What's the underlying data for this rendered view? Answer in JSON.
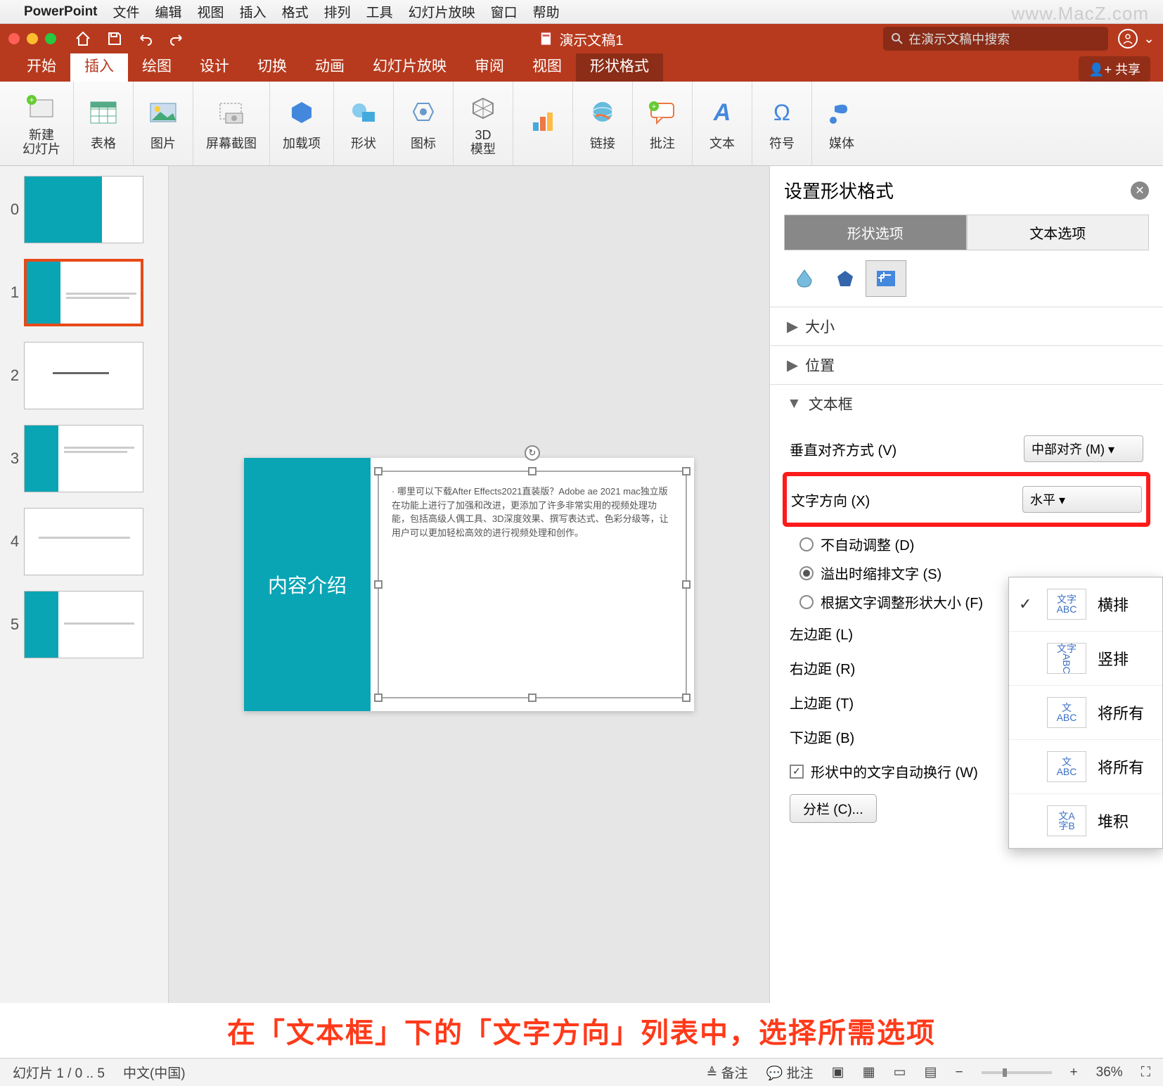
{
  "mac_menu": {
    "app": "PowerPoint",
    "items": [
      "文件",
      "编辑",
      "视图",
      "插入",
      "格式",
      "排列",
      "工具",
      "幻灯片放映",
      "窗口",
      "帮助"
    ]
  },
  "watermark": "www.MacZ.com",
  "titlebar": {
    "doc_title": "演示文稿1",
    "search_placeholder": "在演示文稿中搜索"
  },
  "ribbon_tabs": [
    "开始",
    "插入",
    "绘图",
    "设计",
    "切换",
    "动画",
    "幻灯片放映",
    "审阅",
    "视图",
    "形状格式"
  ],
  "ribbon_tabs_active": 1,
  "share_label": "共享",
  "ribbon_groups": [
    {
      "label": "新建\n幻灯片",
      "icon": "new-slide"
    },
    {
      "label": "表格",
      "icon": "table"
    },
    {
      "label": "图片",
      "icon": "picture"
    },
    {
      "label": "屏幕截图",
      "icon": "screenshot"
    },
    {
      "label": "加载项",
      "icon": "addins"
    },
    {
      "label": "形状",
      "icon": "shapes"
    },
    {
      "label": "图标",
      "icon": "icons"
    },
    {
      "label": "3D\n模型",
      "icon": "3d"
    },
    {
      "label": "",
      "icon": "chart"
    },
    {
      "label": "链接",
      "icon": "link"
    },
    {
      "label": "批注",
      "icon": "comment"
    },
    {
      "label": "文本",
      "icon": "text"
    },
    {
      "label": "符号",
      "icon": "symbol"
    },
    {
      "label": "媒体",
      "icon": "media"
    }
  ],
  "thumbs": [
    {
      "num": "0"
    },
    {
      "num": "1"
    },
    {
      "num": "2"
    },
    {
      "num": "3"
    },
    {
      "num": "4"
    },
    {
      "num": "5"
    }
  ],
  "thumbs_selected": 1,
  "slide": {
    "left_title": "内容介绍",
    "body_text": "· 哪里可以下载After Effects2021直装版？Adobe ae 2021 mac独立版在功能上进行了加强和改进，更添加了许多非常实用的视频处理功能，包括高级人偶工具、3D深度效果、撰写表达式、色彩分级等，让用户可以更加轻松高效的进行视频处理和创作。"
  },
  "format_pane": {
    "title": "设置形状格式",
    "tabs": [
      "形状选项",
      "文本选项"
    ],
    "active_tab": 0,
    "sections": {
      "size": "大小",
      "position": "位置",
      "textbox": "文本框"
    },
    "fields": {
      "valign_label": "垂直对齐方式 (V)",
      "valign_value": "中部对齐 (M)",
      "dir_label": "文字方向 (X)",
      "dir_value": "水平",
      "nofit": "不自动调整 (D)",
      "shrink": "溢出时缩排文字 (S)",
      "resize": "根据文字调整形状大小 (F)",
      "lmargin": "左边距 (L)",
      "rmargin": "右边距 (R)",
      "tmargin": "上边距 (T)",
      "bmargin": "下边距 (B)",
      "wrap": "形状中的文字自动换行 (W)",
      "columns": "分栏 (C)..."
    }
  },
  "dropdown": {
    "items": [
      {
        "label": "横排",
        "checked": true,
        "ico_t": "文字",
        "ico_b": "ABC"
      },
      {
        "label": "竖排",
        "checked": false,
        "ico_t": "文字",
        "ico_b": "ABC"
      },
      {
        "label": "将所有",
        "checked": false,
        "ico_t": "文",
        "ico_b": "ABC"
      },
      {
        "label": "将所有",
        "checked": false,
        "ico_t": "文",
        "ico_b": "ABC"
      },
      {
        "label": "堆积",
        "checked": false,
        "ico_t": "文A",
        "ico_b": "字B"
      }
    ]
  },
  "caption": "在「文本框」下的「文字方向」列表中，选择所需选项",
  "statusbar": {
    "slide_info": "幻灯片 1 / 0 .. 5",
    "lang": "中文(中国)",
    "notes": "备注",
    "comments": "批注",
    "zoom": "36%"
  }
}
